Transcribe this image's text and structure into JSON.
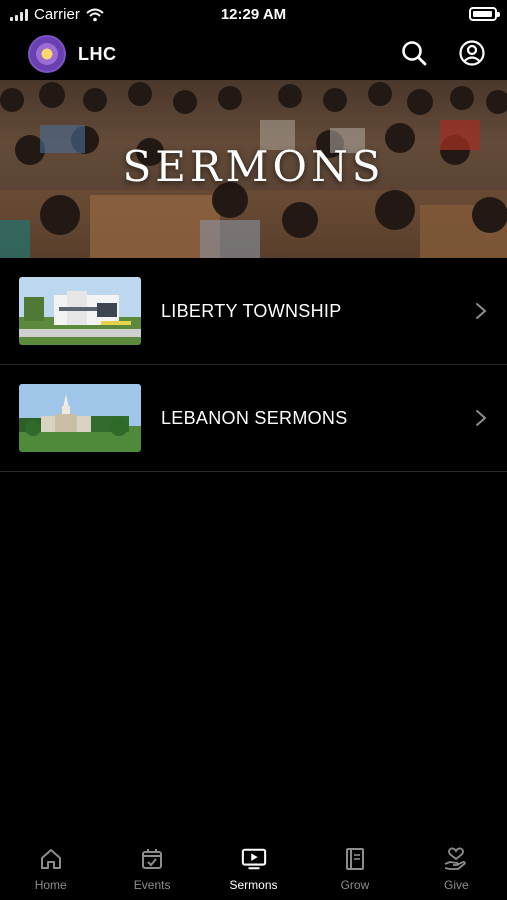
{
  "status_bar": {
    "carrier": "Carrier",
    "time": "12:29 AM",
    "battery_level": 0.95
  },
  "header": {
    "title": "LHC",
    "logo_icon": "globe-logo-icon",
    "search_icon": "search-icon",
    "profile_icon": "profile-icon"
  },
  "hero": {
    "title": "SERMONS"
  },
  "list": {
    "items": [
      {
        "label": "LIBERTY TOWNSHIP",
        "thumb": "church-building-modern"
      },
      {
        "label": "LEBANON SERMONS",
        "thumb": "church-steeple"
      }
    ]
  },
  "tabs": [
    {
      "label": "Home",
      "icon": "home-icon",
      "active": false
    },
    {
      "label": "Events",
      "icon": "calendar-icon",
      "active": false
    },
    {
      "label": "Sermons",
      "icon": "tv-play-icon",
      "active": true
    },
    {
      "label": "Grow",
      "icon": "book-icon",
      "active": false
    },
    {
      "label": "Give",
      "icon": "heart-hand-icon",
      "active": false
    }
  ],
  "colors": {
    "background": "#000000",
    "accent": "#7e53c4",
    "inactive_tab": "#8d8d8d"
  }
}
